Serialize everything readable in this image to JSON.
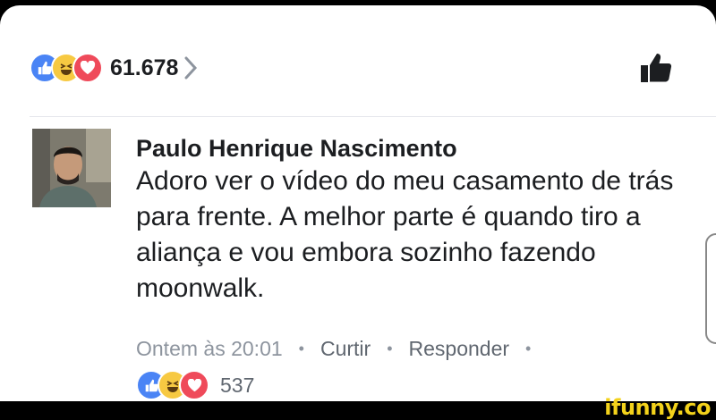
{
  "post": {
    "reaction_icons": [
      "like-icon",
      "haha-icon",
      "love-icon"
    ],
    "reaction_count": "61.678"
  },
  "comment": {
    "author": "Paulo Henrique Nascimento",
    "text": "Adoro ver o vídeo do meu casamento de trás para frente. A melhor parte é quando tiro a aliança e vou embora sozinho fazendo moonwalk.",
    "timestamp": "Ontem às 20:01",
    "actions": {
      "like": "Curtir",
      "reply": "Responder"
    },
    "reaction_icons": [
      "like-icon",
      "haha-icon",
      "love-icon"
    ],
    "reaction_count": "537"
  },
  "watermark": "ifunny.co",
  "colors": {
    "like": "#4a84f5",
    "haha": "#f7c942",
    "love": "#ef4a5a",
    "watermark": "#f3d21b"
  }
}
